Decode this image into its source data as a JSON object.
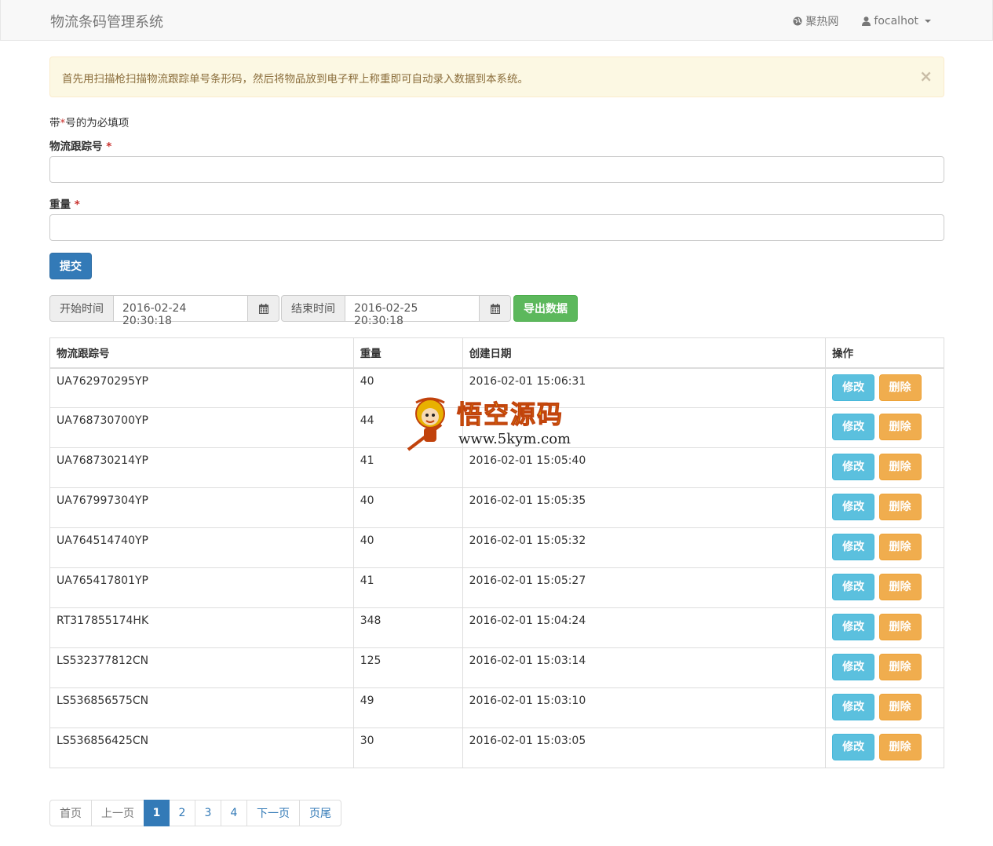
{
  "navbar": {
    "brand": "物流条码管理系统",
    "links": [
      {
        "label": "聚热网",
        "icon": "globe-icon"
      },
      {
        "label": "focalhot",
        "icon": "user-icon"
      }
    ]
  },
  "alert": {
    "text": "首先用扫描枪扫描物流跟踪单号条形码，然后将物品放到电子秤上称重即可自动录入数据到本系统。",
    "close": "×"
  },
  "form": {
    "required_note_prefix": "带",
    "required_note_star": "*",
    "required_note_suffix": "号的为必填项",
    "tracking_label": "物流跟踪号",
    "weight_label": "重量",
    "required_mark": "*",
    "tracking_value": "",
    "weight_value": "",
    "submit_label": "提交"
  },
  "filter": {
    "start_label": "开始时间",
    "start_value": "2016-02-24 20:30:18",
    "end_label": "结束时间",
    "end_value": "2016-02-25 20:30:18",
    "export_label": "导出数据",
    "calendar_icon": "calendar-icon"
  },
  "table": {
    "headers": [
      "物流跟踪号",
      "重量",
      "创建日期",
      "操作"
    ],
    "edit_label": "修改",
    "delete_label": "删除",
    "rows": [
      {
        "tracking": "UA762970295YP",
        "weight": "40",
        "created": "2016-02-01 15:06:31"
      },
      {
        "tracking": "UA768730700YP",
        "weight": "44",
        "created": ""
      },
      {
        "tracking": "UA768730214YP",
        "weight": "41",
        "created": "2016-02-01 15:05:40"
      },
      {
        "tracking": "UA767997304YP",
        "weight": "40",
        "created": "2016-02-01 15:05:35"
      },
      {
        "tracking": "UA764514740YP",
        "weight": "40",
        "created": "2016-02-01 15:05:32"
      },
      {
        "tracking": "UA765417801YP",
        "weight": "41",
        "created": "2016-02-01 15:05:27"
      },
      {
        "tracking": "RT317855174HK",
        "weight": "348",
        "created": "2016-02-01 15:04:24"
      },
      {
        "tracking": "LS532377812CN",
        "weight": "125",
        "created": "2016-02-01 15:03:14"
      },
      {
        "tracking": "LS536856575CN",
        "weight": "49",
        "created": "2016-02-01 15:03:10"
      },
      {
        "tracking": "LS536856425CN",
        "weight": "30",
        "created": "2016-02-01 15:03:05"
      }
    ]
  },
  "pagination": {
    "first": "首页",
    "prev": "上一页",
    "pages": [
      "1",
      "2",
      "3",
      "4"
    ],
    "active": "1",
    "next": "下一页",
    "last": "页尾"
  },
  "watermark": {
    "title": "悟空源码",
    "url": "www.5kym.com"
  },
  "colors": {
    "primary": "#337ab7",
    "success": "#5cb85c",
    "info": "#5bc0de",
    "warning": "#f0ad4e",
    "alert_bg": "#fcf8e3"
  }
}
